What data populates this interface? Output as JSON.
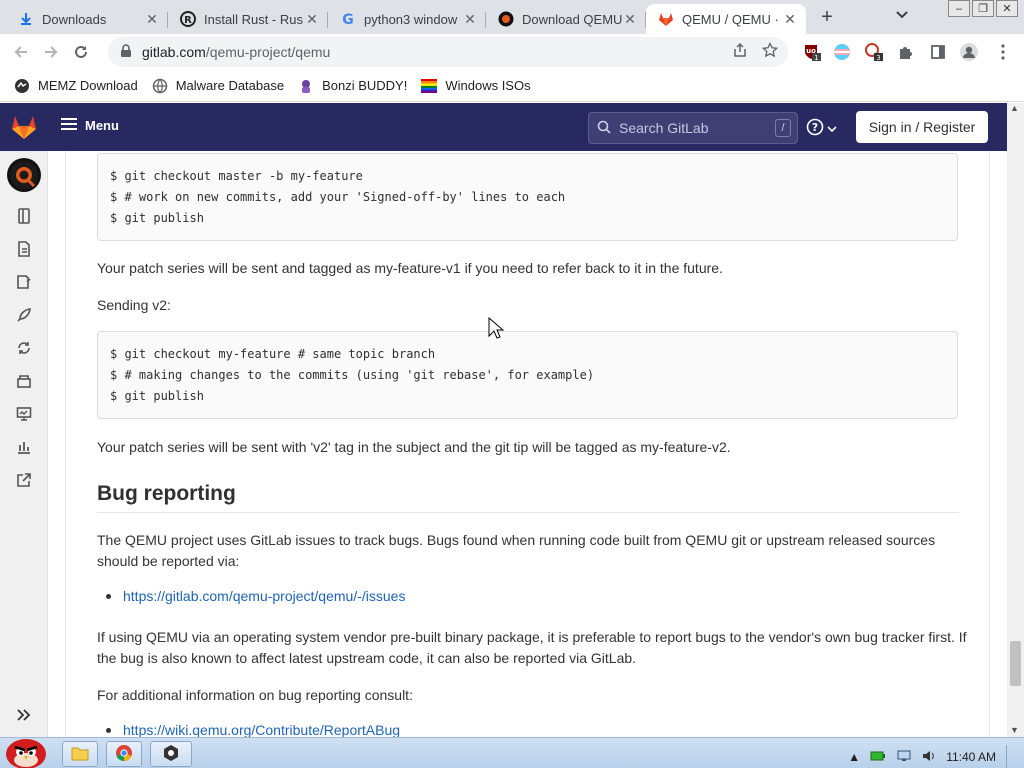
{
  "browser": {
    "tabs": [
      {
        "title": "Downloads",
        "icon": "download-icon"
      },
      {
        "title": "Install Rust - Rus",
        "icon": "rust-icon"
      },
      {
        "title": "python3 window",
        "icon": "google-icon"
      },
      {
        "title": "Download QEMU",
        "icon": "qemu-icon"
      },
      {
        "title": "QEMU / QEMU ·",
        "icon": "gitlab-icon",
        "active": true
      }
    ],
    "new_tab_label": "+",
    "url_host": "gitlab.com",
    "url_path": "/qemu-project/qemu",
    "extension_badges": {
      "ublock": "1",
      "ext3": "3"
    },
    "bookmarks": [
      {
        "label": "MEMZ Download",
        "icon": "memz-icon"
      },
      {
        "label": "Malware Database",
        "icon": "globe-icon"
      },
      {
        "label": "Bonzi BUDDY!",
        "icon": "bonzi-icon"
      },
      {
        "label": "Windows ISOs",
        "icon": "rainbow-flag-icon"
      }
    ]
  },
  "gitlab": {
    "menu_label": "Menu",
    "search_placeholder": "Search GitLab",
    "search_shortcut": "/",
    "signin_label": "Sign in / Register"
  },
  "content": {
    "code1": [
      "$ git checkout master -b my-feature",
      "$ # work on new commits, add your 'Signed-off-by' lines to each",
      "$ git publish"
    ],
    "para1": "Your patch series will be sent and tagged as my-feature-v1 if you need to refer back to it in the future.",
    "para2": "Sending v2:",
    "code2": [
      "$ git checkout my-feature # same topic branch",
      "$ # making changes to the commits (using 'git rebase', for example)",
      "$ git publish"
    ],
    "para3": "Your patch series will be sent with 'v2' tag in the subject and the git tip will be tagged as my-feature-v2.",
    "heading": "Bug reporting",
    "para4": "The QEMU project uses GitLab issues to track bugs. Bugs found when running code built from QEMU git or upstream released sources should be reported via:",
    "link1": "https://gitlab.com/qemu-project/qemu/-/issues",
    "para5": "If using QEMU via an operating system vendor pre-built binary package, it is preferable to report bugs to the vendor's own bug tracker first. If the bug is also known to affect latest upstream code, it can also be reported via GitLab.",
    "para6": "For additional information on bug reporting consult:",
    "link2": "https://wiki.qemu.org/Contribute/ReportABug"
  },
  "taskbar": {
    "clock": "11:40 AM"
  }
}
